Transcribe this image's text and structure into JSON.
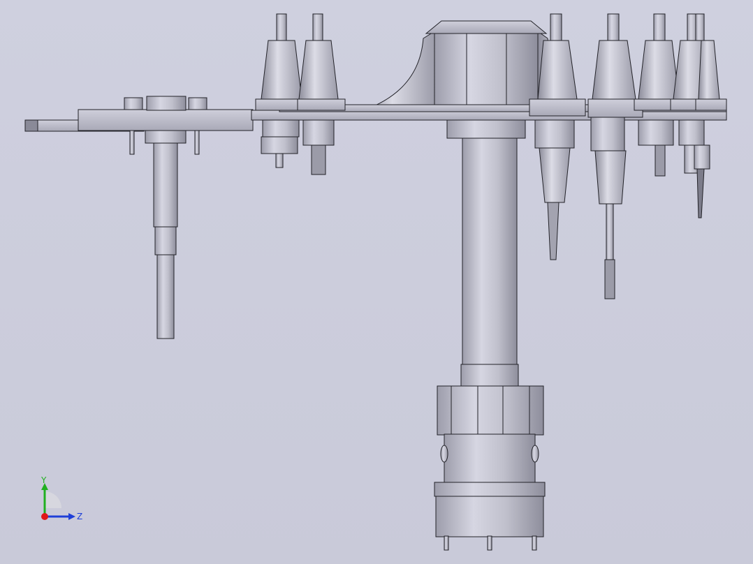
{
  "viewport": {
    "background_top": "#cfd0df",
    "background_bottom": "#c9cad9",
    "model_color": "#b9b9c6",
    "edge_color": "#222228"
  },
  "triad": {
    "x_color": "#e01818",
    "y_color": "#20b020",
    "z_color": "#1f3fd8",
    "y_label": "Y",
    "z_label": "Z"
  }
}
